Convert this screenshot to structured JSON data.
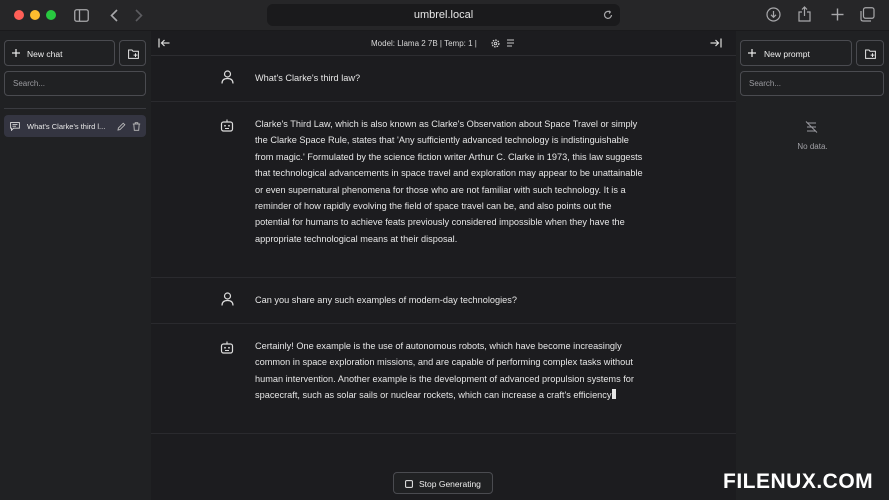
{
  "browser": {
    "url": "umbrel.local"
  },
  "sidebar_left": {
    "new_chat_label": "New chat",
    "search_placeholder": "Search...",
    "conversations": [
      {
        "title": "What's Clarke's third l..."
      }
    ]
  },
  "main": {
    "model_info": "Model: Llama 2 7B | Temp: 1 |",
    "messages": [
      {
        "role": "user",
        "text": "What's Clarke's third law?"
      },
      {
        "role": "assistant",
        "text": "Clarke's Third Law, which is also known as Clarke's Observation about Space Travel or simply the Clarke Space Rule, states that 'Any sufficiently advanced technology is indistinguishable from magic.' Formulated by the science fiction writer Arthur C. Clarke in 1973, this law suggests that technological advancements in space travel and exploration may appear to be unattainable or even supernatural phenomena for those who are not familiar with such technology. It is a reminder of how rapidly evolving the field of space travel can be, and also points out the potential for humans to achieve feats previously considered impossible when they have the appropriate technological means at their disposal."
      },
      {
        "role": "user",
        "text": "Can you share any such examples of modern-day technologies?"
      },
      {
        "role": "assistant",
        "text": "Certainly! One example is the use of autonomous robots, which have become increasingly common in space exploration missions, and are capable of performing complex tasks without human intervention. Another example is the development of advanced propulsion systems for spacecraft, such as solar sails or nuclear rockets, which can increase a craft's efficiency"
      }
    ],
    "stop_label": "Stop Generating"
  },
  "sidebar_right": {
    "new_prompt_label": "New prompt",
    "search_placeholder": "Search...",
    "empty_text": "No data."
  },
  "watermark": "FILENUX.COM",
  "colors": {
    "background": "#202123",
    "chat_background": "#1c1c1f",
    "border": "#4a4b50",
    "close_light": "#ff5f57",
    "minimize_light": "#febc2e",
    "zoom_light": "#28c840"
  }
}
